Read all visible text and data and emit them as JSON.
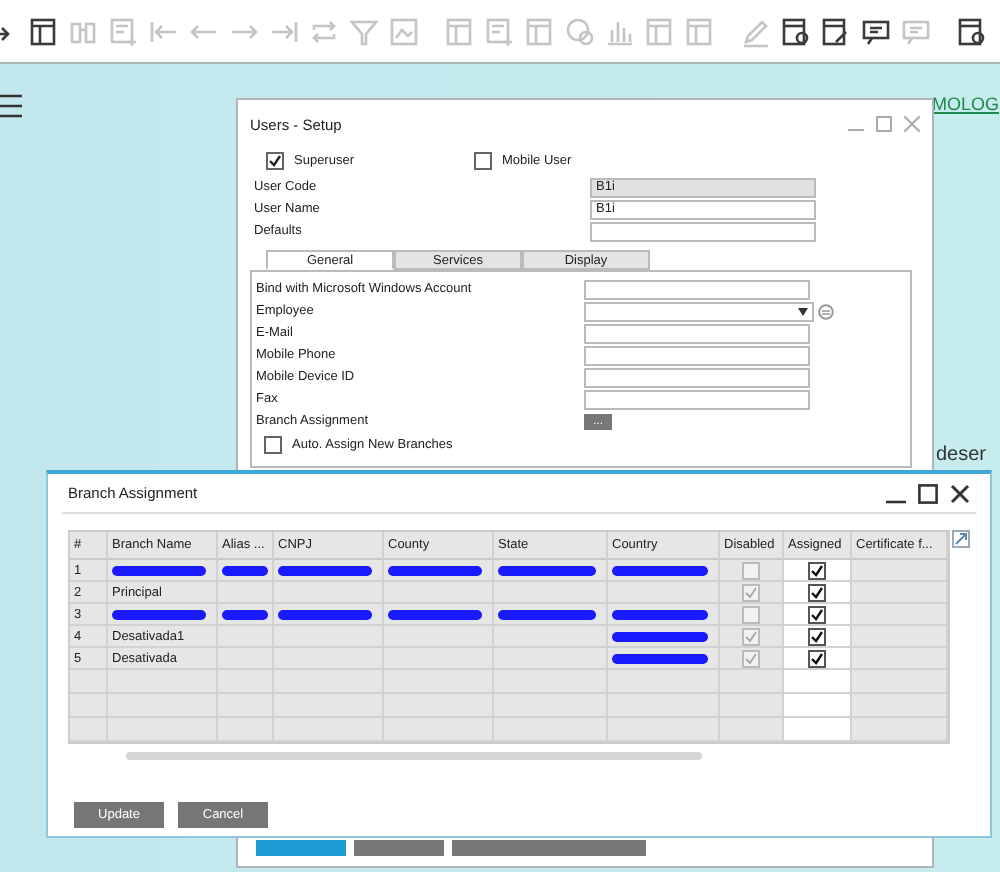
{
  "toolbar": [
    {
      "kind": "redo",
      "disabled": false
    },
    {
      "kind": "doc",
      "disabled": false
    },
    {
      "kind": "search",
      "disabled": true
    },
    {
      "kind": "doc-add",
      "disabled": true
    },
    {
      "kind": "first",
      "disabled": true
    },
    {
      "kind": "prev",
      "disabled": true
    },
    {
      "kind": "next",
      "disabled": true
    },
    {
      "kind": "last",
      "disabled": true
    },
    {
      "kind": "refresh",
      "disabled": true
    },
    {
      "kind": "filter",
      "disabled": true
    },
    {
      "kind": "image",
      "disabled": true
    },
    {
      "kind": "gap"
    },
    {
      "kind": "doc",
      "disabled": true
    },
    {
      "kind": "doc-add",
      "disabled": true
    },
    {
      "kind": "doc",
      "disabled": true
    },
    {
      "kind": "coin",
      "disabled": true
    },
    {
      "kind": "chart",
      "disabled": true
    },
    {
      "kind": "doc",
      "disabled": true
    },
    {
      "kind": "doc",
      "disabled": true
    },
    {
      "kind": "gap"
    },
    {
      "kind": "pencil",
      "disabled": true
    },
    {
      "kind": "doc-gear",
      "disabled": false
    },
    {
      "kind": "doc-edit",
      "disabled": false
    },
    {
      "kind": "comment",
      "disabled": false
    },
    {
      "kind": "comment",
      "disabled": true
    },
    {
      "kind": "gap"
    },
    {
      "kind": "doc-gear",
      "disabled": false
    }
  ],
  "desktop": {
    "link": "MOLOG",
    "note": "deser"
  },
  "users_window": {
    "title": "Users - Setup",
    "checks": [
      {
        "label": "Superuser",
        "checked": true
      },
      {
        "label": "Mobile User",
        "checked": false
      }
    ],
    "fields": [
      {
        "label": "User Code",
        "value": "B1i",
        "disabled": true
      },
      {
        "label": "User Name",
        "value": "B1i",
        "disabled": false
      },
      {
        "label": "Defaults",
        "disabled": false
      }
    ],
    "tabs": [
      {
        "label": "General",
        "selected": true
      },
      {
        "label": "Services",
        "selected": false
      },
      {
        "label": "Display",
        "selected": false
      }
    ],
    "general": [
      {
        "label": "Bind with Microsoft Windows Account",
        "kind": "text"
      },
      {
        "label": "Employee",
        "kind": "dropdown"
      },
      {
        "label": "E-Mail",
        "kind": "text"
      },
      {
        "label": "Mobile Phone",
        "kind": "text"
      },
      {
        "label": "Mobile Device ID",
        "kind": "text"
      },
      {
        "label": "Fax",
        "kind": "text"
      },
      {
        "label": "Branch Assignment",
        "kind": "browse",
        "button": "..."
      }
    ],
    "auto_assign": {
      "label": "Auto. Assign New Branches",
      "checked": false
    },
    "footer_buttons": [
      {
        "kind": "primary"
      },
      {
        "kind": "secondary"
      },
      {
        "kind": "wide"
      }
    ]
  },
  "branch_window": {
    "title": "Branch Assignment",
    "columns": [
      "#",
      "Branch Name",
      "Alias ...",
      "CNPJ",
      "County",
      "State",
      "Country",
      "Disabled",
      "Assigned",
      "Certificate f..."
    ],
    "rows": [
      {
        "number": "1",
        "cells": [
          {
            "kind": "redacted"
          },
          {
            "kind": "redacted"
          },
          {
            "kind": "redacted"
          },
          {
            "kind": "redacted"
          },
          {
            "kind": "redacted"
          },
          {
            "kind": "redacted"
          }
        ],
        "disabled": false,
        "assigned": true
      },
      {
        "number": "2",
        "cells": [
          {
            "kind": "text",
            "text": "Principal"
          },
          {
            "kind": "empty"
          },
          {
            "kind": "empty"
          },
          {
            "kind": "empty"
          },
          {
            "kind": "empty"
          },
          {
            "kind": "empty"
          }
        ],
        "disabled": true,
        "assigned": true
      },
      {
        "number": "3",
        "cells": [
          {
            "kind": "redacted"
          },
          {
            "kind": "redacted"
          },
          {
            "kind": "redacted"
          },
          {
            "kind": "redacted"
          },
          {
            "kind": "redacted"
          },
          {
            "kind": "redacted"
          }
        ],
        "disabled": false,
        "assigned": true
      },
      {
        "number": "4",
        "cells": [
          {
            "kind": "text",
            "text": "Desativada1"
          },
          {
            "kind": "empty"
          },
          {
            "kind": "empty"
          },
          {
            "kind": "empty"
          },
          {
            "kind": "empty"
          },
          {
            "kind": "redacted"
          }
        ],
        "disabled": true,
        "assigned": true
      },
      {
        "number": "5",
        "cells": [
          {
            "kind": "text",
            "text": "Desativada"
          },
          {
            "kind": "empty"
          },
          {
            "kind": "empty"
          },
          {
            "kind": "empty"
          },
          {
            "kind": "empty"
          },
          {
            "kind": "redacted"
          }
        ],
        "disabled": true,
        "assigned": true
      }
    ],
    "buttons": [
      "Update",
      "Cancel"
    ]
  }
}
